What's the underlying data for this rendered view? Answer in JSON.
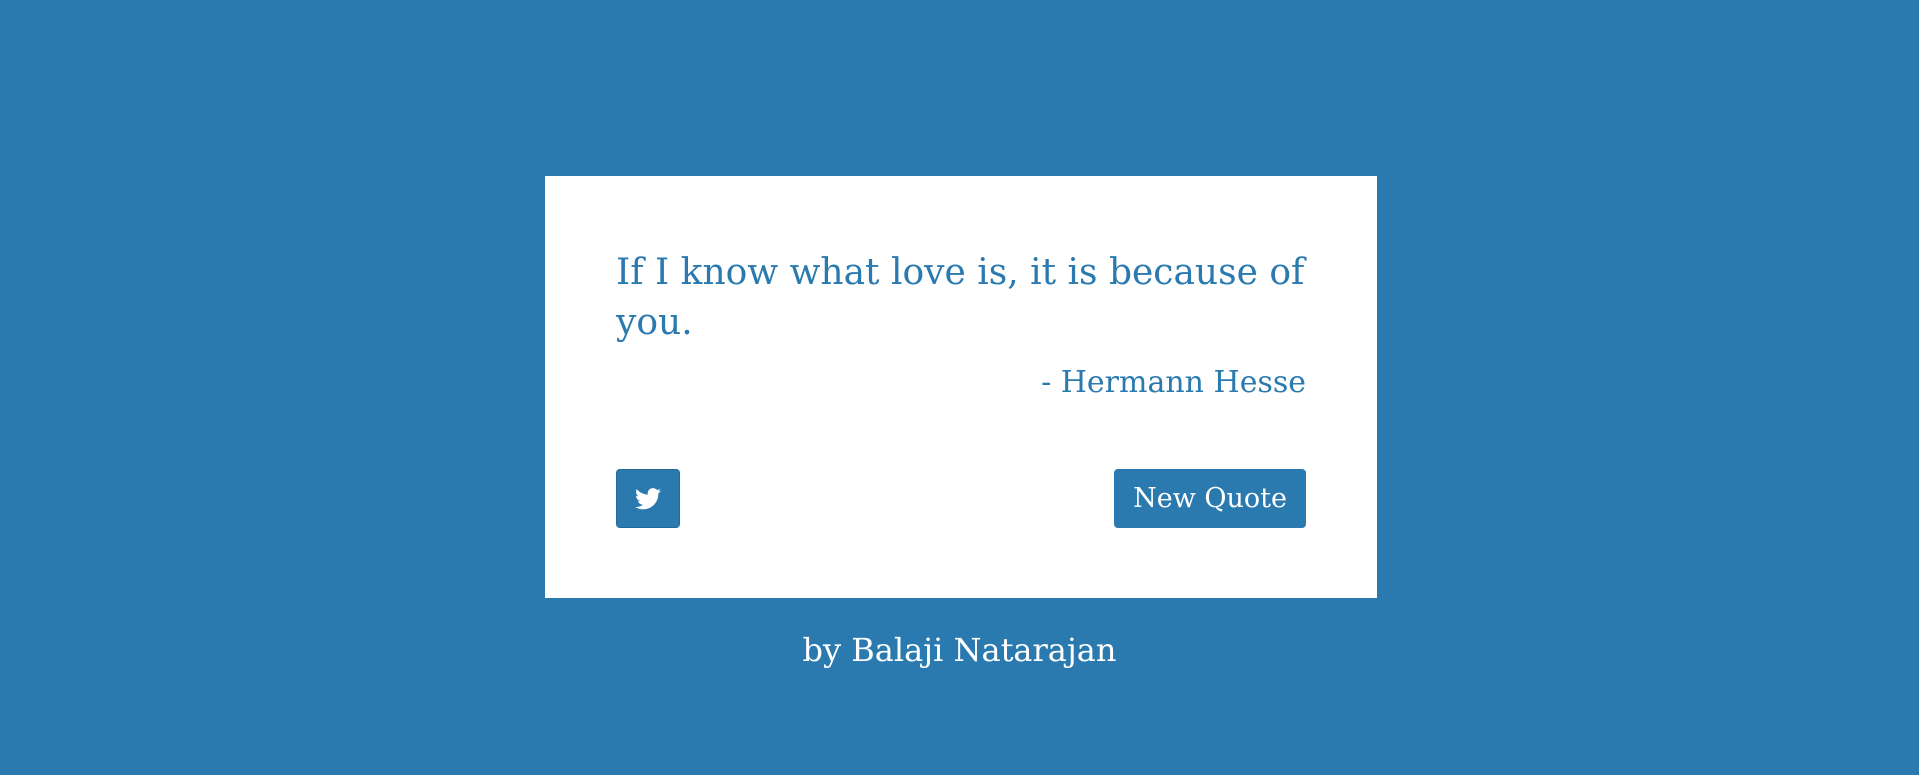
{
  "quote": {
    "text": "If I know what love is, it is because of you.",
    "author": "- Hermann Hesse"
  },
  "actions": {
    "tweet_icon": "twitter-icon",
    "new_quote_label": "New Quote"
  },
  "footer": {
    "credit": "by Balaji Natarajan"
  },
  "colors": {
    "background": "#2a7ab0",
    "card": "#ffffff",
    "accent": "#2a7ab0",
    "button_text": "#ffffff"
  }
}
